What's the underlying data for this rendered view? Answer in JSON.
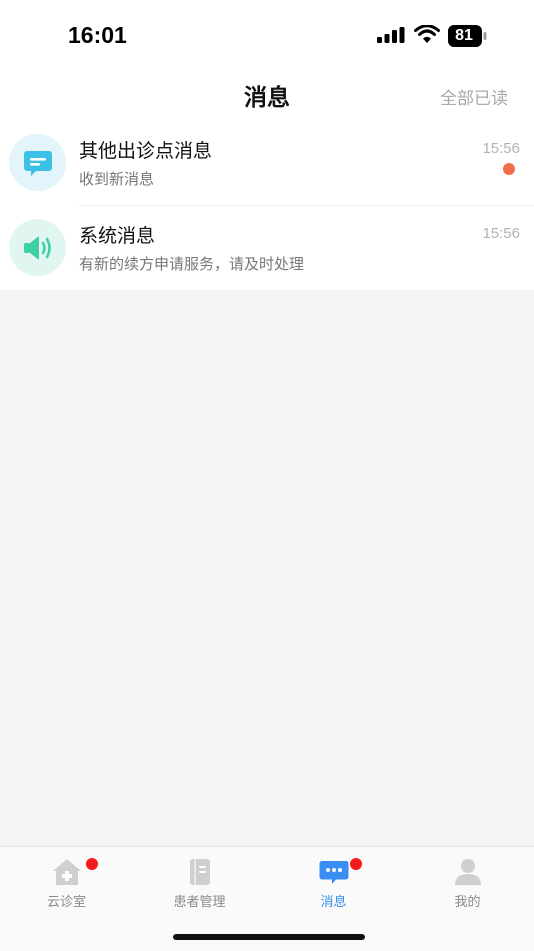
{
  "status_bar": {
    "time": "16:01",
    "battery": "81"
  },
  "header": {
    "title": "消息",
    "mark_all_read": "全部已读"
  },
  "messages": [
    {
      "title": "其他出诊点消息",
      "subtitle": "收到新消息",
      "time": "15:56",
      "unread": true,
      "icon": "chat-bubble-icon",
      "accent": "#3cc1e6"
    },
    {
      "title": "系统消息",
      "subtitle": "有新的续方申请服务，请及时处理",
      "time": "15:56",
      "unread": false,
      "icon": "speaker-icon",
      "accent": "#3ccfa8"
    }
  ],
  "tabs": [
    {
      "label": "云诊室",
      "badge": true,
      "active": false,
      "icon": "clinic-house-icon"
    },
    {
      "label": "患者管理",
      "badge": false,
      "active": false,
      "icon": "notebook-icon"
    },
    {
      "label": "消息",
      "badge": true,
      "active": true,
      "icon": "message-icon"
    },
    {
      "label": "我的",
      "badge": false,
      "active": false,
      "icon": "profile-icon"
    }
  ],
  "colors": {
    "active_tab": "#3a8ef1",
    "unread_dot": "#f36d4a",
    "badge": "#f21b1b"
  }
}
